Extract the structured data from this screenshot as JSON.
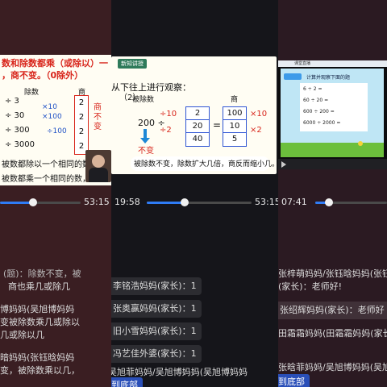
{
  "panel_left": {
    "slide_title_line1": "数和除数都乘（或除以）一",
    "slide_title_line2": "，商不变。（0除外）",
    "col_dividend": "除数",
    "col_quotient": "商",
    "dividend_rows": [
      "÷ 3",
      "÷ 30",
      "÷ 300",
      "÷ 3000"
    ],
    "dividend_times": [
      "×10",
      "×100",
      "÷100"
    ],
    "quotient_vals": [
      "2",
      "2",
      "2",
      "2"
    ],
    "quotient_note": "商不变",
    "rule_line1": "被数都除以一个相同的数，",
    "rule_line2": "被数都乘一个相同的数，商",
    "time_total": "53:15",
    "progress": 0.38,
    "chat": [
      {
        "text": "(题)：除数不变，被"
      },
      {
        "text": "商也乘几或除几"
      },
      {
        "text": "博妈妈(吴旭博妈妈"
      },
      {
        "text": "变被除数乘几或除以"
      },
      {
        "text": "几或除以几"
      },
      {
        "text": "暗妈妈(张钰晗妈妈"
      },
      {
        "text": "变，被除数乘以几，"
      }
    ]
  },
  "panel_mid": {
    "tag": "新知讲授",
    "instruction": "从下往上进行观察：",
    "subnum": "（2）",
    "col_dividend": "被除数",
    "col_quotient": "商",
    "expr_prefix": "200 ÷",
    "divisor_ops": [
      "÷10",
      "÷2"
    ],
    "divisors": [
      "2",
      "20",
      "40"
    ],
    "quotients": [
      "100",
      "10",
      "5"
    ],
    "quotient_ops": [
      "×10",
      "×2"
    ],
    "unchanged_label": "不变",
    "conclusion": "被除数不变，除数扩大几倍，商反而缩小几。",
    "time_elapsed": "19:58",
    "time_total": "53:15",
    "progress": 0.44,
    "chat": [
      {
        "text": "李铭浩妈妈(家长)：1"
      },
      {
        "text": "张奥赢妈妈(家长)：1"
      },
      {
        "text": "旧小雪妈妈(家长)：1"
      },
      {
        "text": "冯艺佳外婆(家长)：1"
      },
      {
        "text": "吴旭菲妈妈/吴旭博妈妈(吴旭博妈妈"
      }
    ],
    "back_to_bottom": "到底部"
  },
  "panel_right": {
    "app_title": "课堂直播",
    "task_text": "计算并观察下面的题",
    "table_rows": [
      [
        "6",
        "÷",
        "2",
        "="
      ],
      [
        "60",
        "÷",
        "20",
        "="
      ],
      [
        "600",
        "÷",
        "200",
        "="
      ],
      [
        "6000",
        "÷",
        "2000",
        "="
      ]
    ],
    "time_elapsed": "07:41",
    "progress": 0.48,
    "chat": [
      {
        "text": "张梓萌妈妈/张钰晗妈妈(张钰"
      },
      {
        "text": "(家长)：老师好!"
      },
      {
        "text": "张绍辉妈妈(家长)：老师好"
      },
      {
        "text": "田霜霜妈妈(田霜霜妈妈(家长"
      },
      {
        "text": "张晗菲妈妈/吴旭博妈妈(吴旭"
      },
      {
        "text": "到底部"
      }
    ]
  }
}
